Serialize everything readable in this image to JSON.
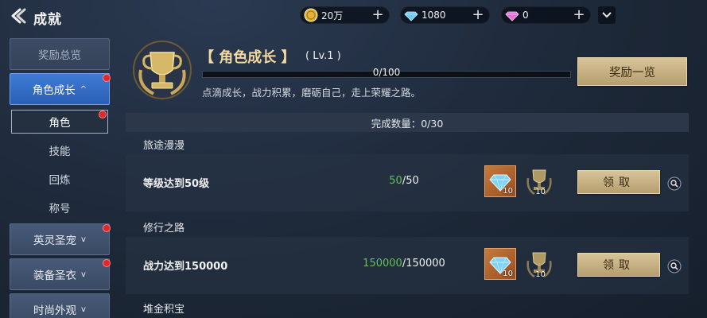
{
  "header": {
    "title": "成就",
    "currencies": [
      {
        "name": "gold-coin",
        "value": "20万",
        "color": "#e2b43c"
      },
      {
        "name": "blue-diamond",
        "value": "1080",
        "color": "#6ec9f2"
      },
      {
        "name": "pink-diamond",
        "value": "0",
        "color": "#e26fd8"
      }
    ]
  },
  "sidebar": {
    "categories": [
      {
        "label": "奖励总览"
      },
      {
        "label": "角色成长",
        "chevron": "^"
      },
      {
        "label": "英灵圣宠",
        "chevron": "v"
      },
      {
        "label": "装备圣衣",
        "chevron": "v"
      },
      {
        "label": "时尚外观",
        "chevron": "v"
      }
    ],
    "subitems": [
      "角色",
      "技能",
      "回炼",
      "称号"
    ]
  },
  "category": {
    "title": "【 角色成长 】",
    "level": "( Lv.1 )",
    "progress_text": "0/100",
    "progress_fraction": 0,
    "description": "点滴成长，战力积累，磨砺自己，走上荣耀之路。",
    "overview_button": "奖励一览"
  },
  "list": {
    "summary": "完成数量：0/30",
    "sections": [
      {
        "title": "旅途漫漫",
        "name": "等级达到50级",
        "current": "50",
        "total": "/50",
        "rewards": [
          {
            "icon": "diamond-icon",
            "qty": "10"
          },
          {
            "icon": "trophy-icon",
            "qty": "10"
          }
        ],
        "claim": "领取"
      },
      {
        "title": "修行之路",
        "name": "战力达到150000",
        "current": "150000",
        "total": "/150000",
        "rewards": [
          {
            "icon": "diamond-icon",
            "qty": "10"
          },
          {
            "icon": "trophy-icon",
            "qty": "10"
          }
        ],
        "claim": "领取"
      },
      {
        "title": "堆金积宝"
      }
    ]
  }
}
